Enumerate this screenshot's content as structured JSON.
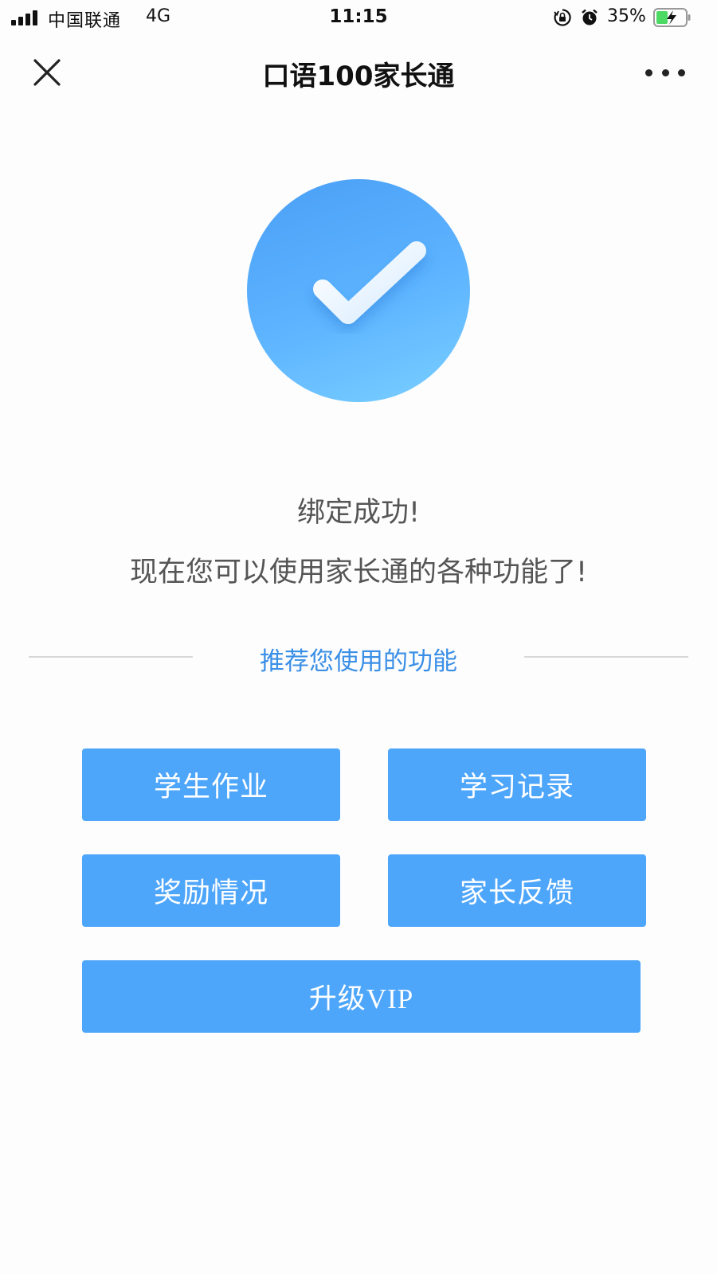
{
  "status_bar": {
    "carrier": "中国联通",
    "network": "4G",
    "time": "11:15",
    "battery_percent": "35%",
    "icons": [
      "signal-icon",
      "rotation-lock-icon",
      "alarm-icon",
      "battery-charging-icon"
    ]
  },
  "nav": {
    "title": "口语100家长通",
    "close_icon": "close-icon",
    "more_icon": "more-icon"
  },
  "result": {
    "icon": "checkmark-icon",
    "line1": "绑定成功!",
    "line2": "现在您可以使用家长通的各种功能了!"
  },
  "recommend": {
    "title": "推荐您使用的功能",
    "buttons": {
      "homework": "学生作业",
      "records": "学习记录",
      "rewards": "奖励情况",
      "feedback": "家长反馈",
      "vip": "升级VIP"
    }
  },
  "colors": {
    "accent": "#4ea6fb",
    "section_title": "#3a8fe6",
    "circle_top": "#4a9ff6",
    "circle_bottom": "#79cfff"
  }
}
